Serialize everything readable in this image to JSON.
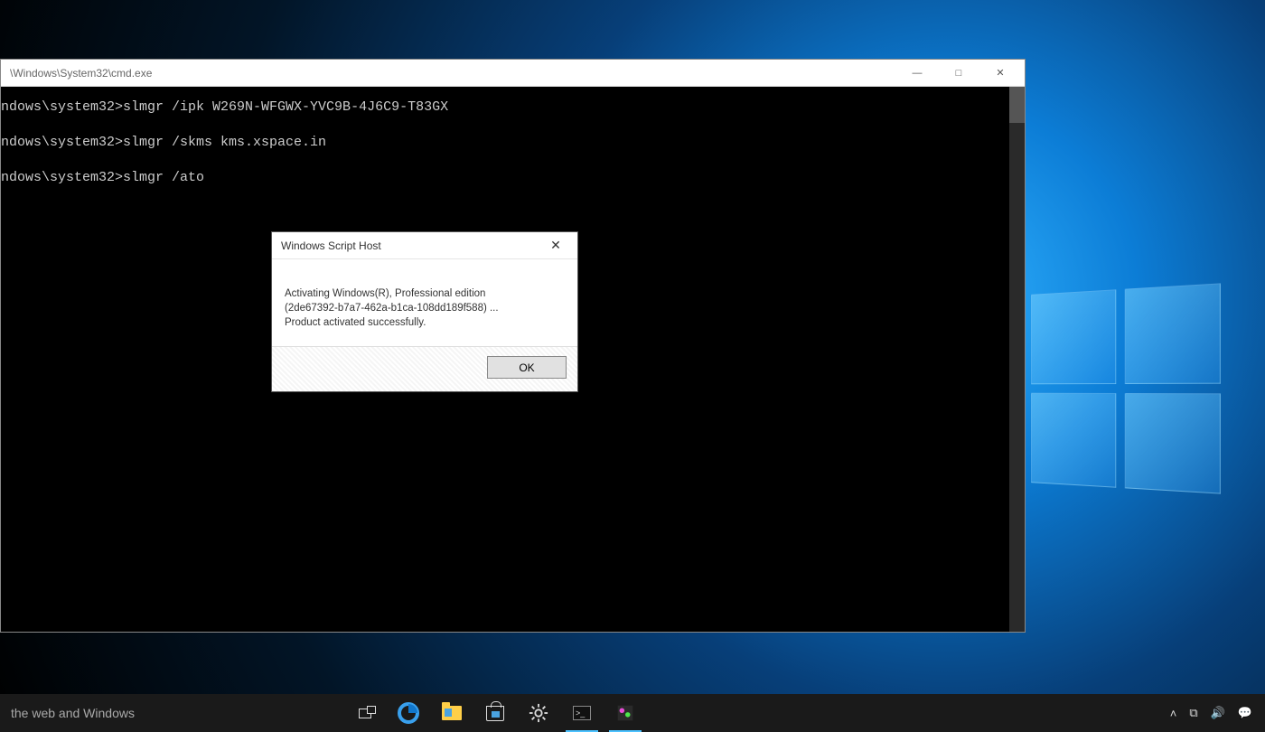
{
  "desktop": {
    "wallpaper": "windows-10-light"
  },
  "cmd": {
    "title": "\\Windows\\System32\\cmd.exe",
    "lines": [
      "ndows\\system32>slmgr /ipk W269N-WFGWX-YVC9B-4J6C9-T83GX",
      "ndows\\system32>slmgr /skms kms.xspace.in",
      "ndows\\system32>slmgr /ato"
    ],
    "controls": {
      "minimize": "—",
      "maximize": "□",
      "close": "✕"
    }
  },
  "dialog": {
    "title": "Windows Script Host",
    "line1": "Activating Windows(R), Professional edition",
    "line2": "(2de67392-b7a7-462a-b1ca-108dd189f588) ...",
    "line3": "Product activated successfully.",
    "ok": "OK",
    "close": "✕"
  },
  "taskbar": {
    "search_placeholder": "the web and Windows",
    "tray": {
      "chevron": "˄",
      "network": "⧉",
      "volume": "🔊",
      "notifications": "💬"
    }
  }
}
